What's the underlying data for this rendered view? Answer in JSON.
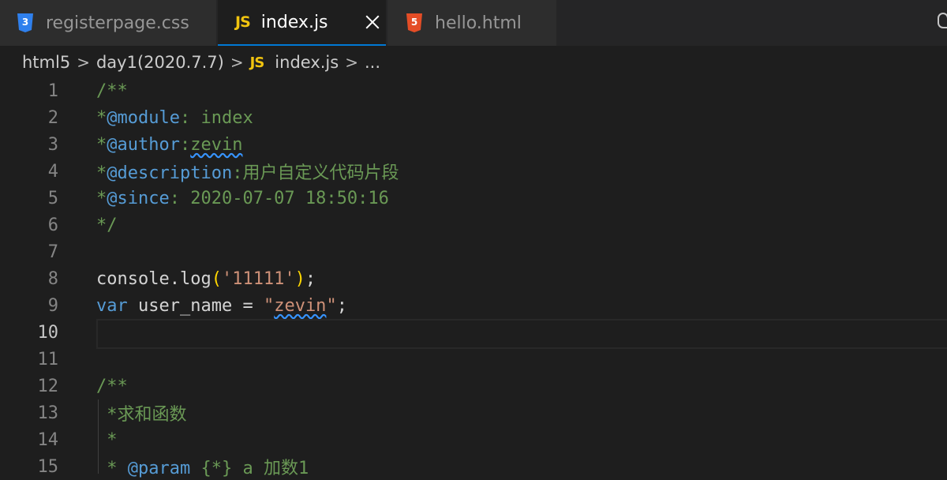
{
  "tabs": [
    {
      "label": "registerpage.css",
      "icon": "css3-icon",
      "active": false
    },
    {
      "label": "index.js",
      "icon": "js-icon",
      "icon_text": "JS",
      "active": true
    },
    {
      "label": "hello.html",
      "icon": "html5-icon",
      "active": false
    }
  ],
  "breadcrumb": {
    "items": [
      "html5",
      "day1(2020.7.7)",
      "index.js",
      "..."
    ],
    "separator": ">",
    "js_badge": "JS"
  },
  "editor": {
    "current_line": 10,
    "lines": [
      {
        "number": "1",
        "text": "/**"
      },
      {
        "number": "2",
        "text": "*@module: index"
      },
      {
        "number": "3",
        "text": "*@author:zevin"
      },
      {
        "number": "4",
        "text": "*@description:用户自定义代码片段"
      },
      {
        "number": "5",
        "text": "*@since: 2020-07-07 18:50:16"
      },
      {
        "number": "6",
        "text": "*/"
      },
      {
        "number": "7",
        "text": ""
      },
      {
        "number": "8",
        "text": "console.log('11111');"
      },
      {
        "number": "9",
        "text": "var user_name = \"zevin\";"
      },
      {
        "number": "10",
        "text": ""
      },
      {
        "number": "11",
        "text": ""
      },
      {
        "number": "12",
        "text": "/**"
      },
      {
        "number": "13",
        "text": " *求和函数"
      },
      {
        "number": "14",
        "text": " *"
      },
      {
        "number": "15",
        "text": " * @param {*} a 加数1"
      }
    ],
    "tokens": {
      "l1": "/**",
      "l2_star": "*",
      "l2_tag": "@module",
      "l2_rest": ": index",
      "l3_star": "*",
      "l3_tag": "@author",
      "l3_colon": ":",
      "l3_val": "zevin",
      "l4_star": "*",
      "l4_tag": "@description",
      "l4_rest": ":用户自定义代码片段",
      "l5_star": "*",
      "l5_tag": "@since",
      "l5_rest": ": 2020-07-07 18:50:16",
      "l6": "*/",
      "l8_obj": "console.log",
      "l8_paren_open": "(",
      "l8_str": "'11111'",
      "l8_paren_close": ")",
      "l8_semi": ";",
      "l9_kw": "var",
      "l9_ident": " user_name",
      "l9_eq": " = ",
      "l9_q1": "\"",
      "l9_strval": "zevin",
      "l9_q2": "\"",
      "l9_semi": ";",
      "l12": "/**",
      "l13": " *求和函数",
      "l14": " *",
      "l15_pre": " * ",
      "l15_tag": "@param",
      "l15_type": " {*}",
      "l15_rest": " a 加数1"
    }
  },
  "colors": {
    "comment": "#6a9955",
    "keyword": "#569cd6",
    "string": "#ce9178",
    "accent": "#0078d4",
    "js_badge": "#f1c40f",
    "css_badge": "#2f80ed",
    "html_badge": "#e44d26"
  }
}
